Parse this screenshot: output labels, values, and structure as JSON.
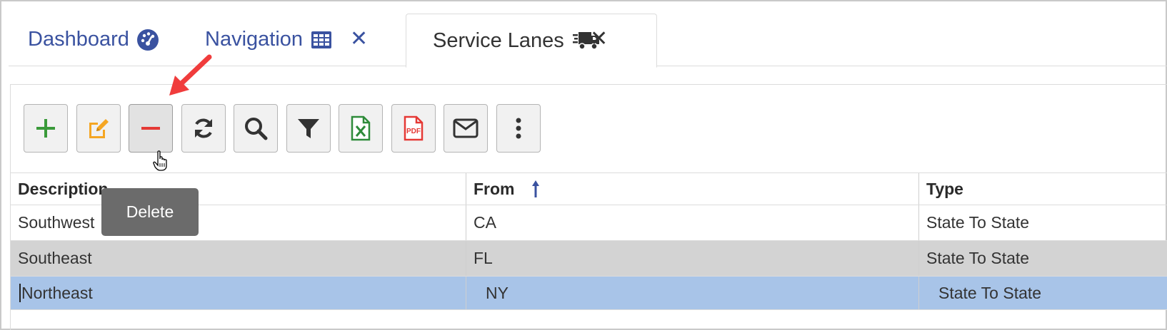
{
  "tabs": [
    {
      "label": "Dashboard",
      "icon": "dashboard-gauge-icon",
      "closable": false,
      "active": false
    },
    {
      "label": "Navigation",
      "icon": "grid-table-icon",
      "closable": true,
      "active": false
    },
    {
      "label": "Service Lanes",
      "icon": "truck-fast-icon",
      "closable": true,
      "active": true
    }
  ],
  "tab_close_glyph": "✕",
  "toolbar": {
    "buttons": [
      {
        "name": "add",
        "icon": "plus-icon"
      },
      {
        "name": "edit",
        "icon": "edit-icon"
      },
      {
        "name": "delete",
        "icon": "minus-icon"
      },
      {
        "name": "refresh",
        "icon": "refresh-icon"
      },
      {
        "name": "search",
        "icon": "search-icon"
      },
      {
        "name": "filter",
        "icon": "filter-icon"
      },
      {
        "name": "export-excel",
        "icon": "excel-file-icon"
      },
      {
        "name": "export-pdf",
        "icon": "pdf-file-icon",
        "icon_text": "PDF"
      },
      {
        "name": "email",
        "icon": "envelope-icon"
      },
      {
        "name": "more",
        "icon": "vertical-dots-icon"
      }
    ],
    "tooltip": "Delete"
  },
  "grid": {
    "columns": [
      "Description",
      "From",
      "Type"
    ],
    "sort": {
      "column": "From",
      "direction": "ascending",
      "icon": "sort-up-arrow-icon"
    },
    "rows": [
      {
        "description": "Southwest",
        "from": "CA",
        "type": "State To State",
        "state": "normal"
      },
      {
        "description": "Southeast",
        "from": "FL",
        "type": "State To State",
        "state": "alternate"
      },
      {
        "description": "Northeast",
        "from": "NY",
        "type": "State To State",
        "state": "selected-editing"
      }
    ]
  },
  "colors": {
    "accent": "#3a52a0",
    "add_green": "#3a9a3a",
    "edit_orange": "#f5a623",
    "delete_red": "#e53935",
    "excel_green": "#2e8b3a",
    "pdf_red": "#e53935",
    "selected_row": "#a8c4e8",
    "alternate_row": "#d3d3d3",
    "tooltip_bg": "#6b6b6b",
    "annotation_arrow": "#f03c3c"
  }
}
